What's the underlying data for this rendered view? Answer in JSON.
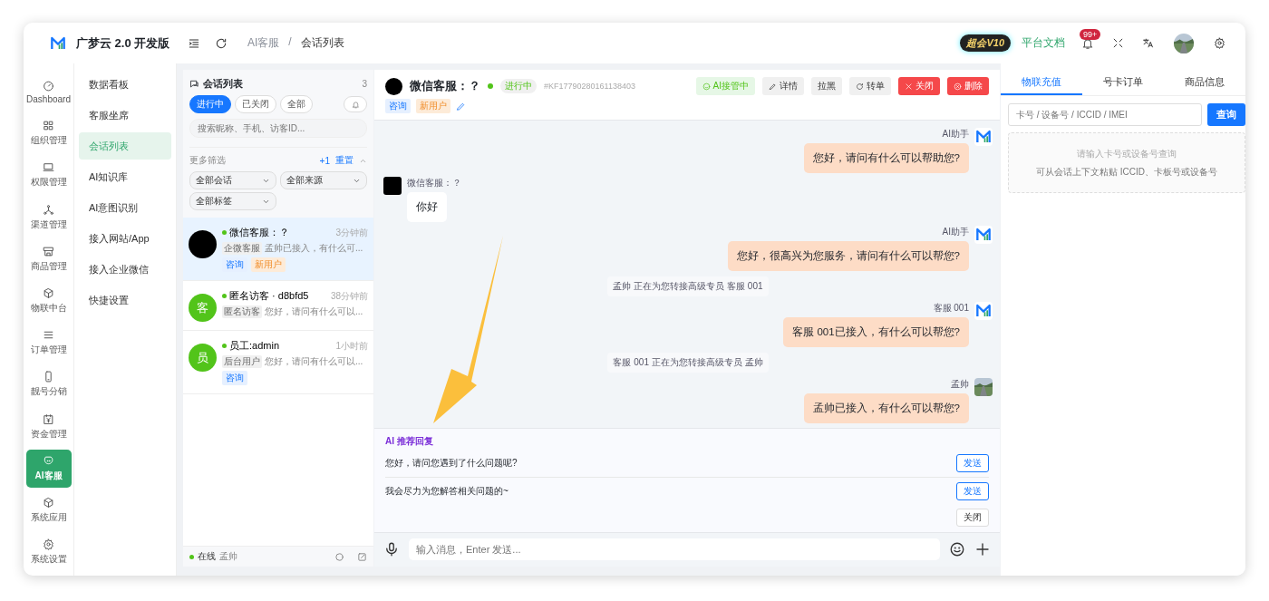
{
  "brand": "广梦云 2.0 开发版",
  "breadcrumb": {
    "items": [
      "AI客服",
      "会话列表"
    ],
    "separator": "/"
  },
  "topbar": {
    "vip": "超会V10",
    "docs": "平台文档",
    "notifications": "99+"
  },
  "rail": [
    {
      "label": "Dashboard",
      "selected": false
    },
    {
      "label": "组织管理",
      "selected": false
    },
    {
      "label": "权限管理",
      "selected": false
    },
    {
      "label": "渠道管理",
      "selected": false
    },
    {
      "label": "商品管理",
      "selected": false
    },
    {
      "label": "物联中台",
      "selected": false
    },
    {
      "label": "订单管理",
      "selected": false
    },
    {
      "label": "靓号分销",
      "selected": false
    },
    {
      "label": "资金管理",
      "selected": false
    },
    {
      "label": "AI客服",
      "selected": true
    },
    {
      "label": "系统应用",
      "selected": false
    },
    {
      "label": "系统设置",
      "selected": false
    }
  ],
  "submenu": [
    {
      "label": "数据看板",
      "selected": false
    },
    {
      "label": "客服坐席",
      "selected": false
    },
    {
      "label": "会话列表",
      "selected": true
    },
    {
      "label": "AI知识库",
      "selected": false
    },
    {
      "label": "AI意图识别",
      "selected": false
    },
    {
      "label": "接入网站/App",
      "selected": false
    },
    {
      "label": "接入企业微信",
      "selected": false
    },
    {
      "label": "快捷设置",
      "selected": false
    }
  ],
  "conversation_list": {
    "title": "会话列表",
    "count": "3",
    "filters": [
      {
        "label": "进行中",
        "selected": true
      },
      {
        "label": "已关闭",
        "selected": false
      },
      {
        "label": "全部",
        "selected": false
      }
    ],
    "search": {
      "placeholder": "搜索昵称、手机、访客ID..."
    },
    "more_filters": "更多筛选",
    "filter_count": "+1",
    "reset": "重置",
    "selects": [
      "全部会话",
      "全部来源",
      "全部标签"
    ],
    "items": [
      {
        "name": "微信客服：？",
        "time": "3分钟前",
        "source": "企微客服",
        "preview": "孟帅已接入，有什么可...",
        "online": true,
        "selected": true,
        "tags": [
          {
            "label": "咨询",
            "kind": "consult"
          },
          {
            "label": "新用户",
            "kind": "new"
          }
        ]
      },
      {
        "name": "匿名访客 · d8bfd5",
        "time": "38分钟前",
        "source": "匿名访客",
        "preview": "您好，请问有什么可以...",
        "avatar": "客",
        "online": true,
        "selected": false
      },
      {
        "name": "员工:admin",
        "time": "1小时前",
        "source": "后台用户",
        "preview": "您好，请问有什么可以...",
        "avatar": "员",
        "online": true,
        "selected": false,
        "tags": [
          {
            "label": "咨询",
            "kind": "consult"
          }
        ]
      }
    ],
    "footer": {
      "status": "在线",
      "user": "孟帅"
    }
  },
  "chat": {
    "name": "微信客服：？",
    "status": "进行中",
    "id": "#KF17790280161138403",
    "tags": [
      {
        "label": "咨询",
        "kind": "consult"
      },
      {
        "label": "新用户",
        "kind": "new"
      }
    ],
    "actions": [
      {
        "label": "AI接管中",
        "kind": "ai"
      },
      {
        "label": "详情",
        "kind": "edit"
      },
      {
        "label": "拉黑",
        "kind": "plain"
      },
      {
        "label": "转单",
        "kind": "transfer"
      },
      {
        "label": "关闭",
        "kind": "close"
      },
      {
        "label": "删除",
        "kind": "delete"
      }
    ],
    "messages": [
      {
        "kind": "outgoing",
        "sender": "AI助手",
        "text": "您好，请问有什么可以帮助您?",
        "photo_avatar": false
      },
      {
        "kind": "incoming",
        "sender": "微信客服：？",
        "text": "你好"
      },
      {
        "kind": "outgoing",
        "sender": "AI助手",
        "text": "您好，很高兴为您服务，请问有什么可以帮您?",
        "photo_avatar": false
      },
      {
        "kind": "system",
        "text": "孟帅 正在为您转接高级专员 客服 001"
      },
      {
        "kind": "outgoing",
        "sender": "客服 001",
        "text": "客服 001已接入，有什么可以帮您?",
        "photo_avatar": false
      },
      {
        "kind": "system",
        "text": "客服 001 正在为您转接高级专员 孟帅"
      },
      {
        "kind": "outgoing",
        "sender": "孟帅",
        "text": "孟帅已接入，有什么可以帮您?",
        "photo_avatar": true
      }
    ],
    "suggestions": {
      "title": "AI 推荐回复",
      "items": [
        {
          "text": "您好，请问您遇到了什么问题呢?",
          "button": "发送"
        },
        {
          "text": "我会尽力为您解答相关问题的~",
          "button": "发送"
        }
      ],
      "close": "关闭"
    },
    "composer": {
      "placeholder": "输入消息，Enter 发送..."
    }
  },
  "side_panel": {
    "tabs": [
      {
        "label": "物联充值",
        "selected": true
      },
      {
        "label": "号卡订单",
        "selected": false
      },
      {
        "label": "商品信息",
        "selected": false
      }
    ],
    "search": {
      "placeholder": "卡号 / 设备号 / ICCID / IMEI",
      "button": "查询"
    },
    "empty_title": "请输入卡号或设备号查询",
    "empty_hint": "可从会话上下文粘贴 ICCID、卡板号或设备号"
  }
}
